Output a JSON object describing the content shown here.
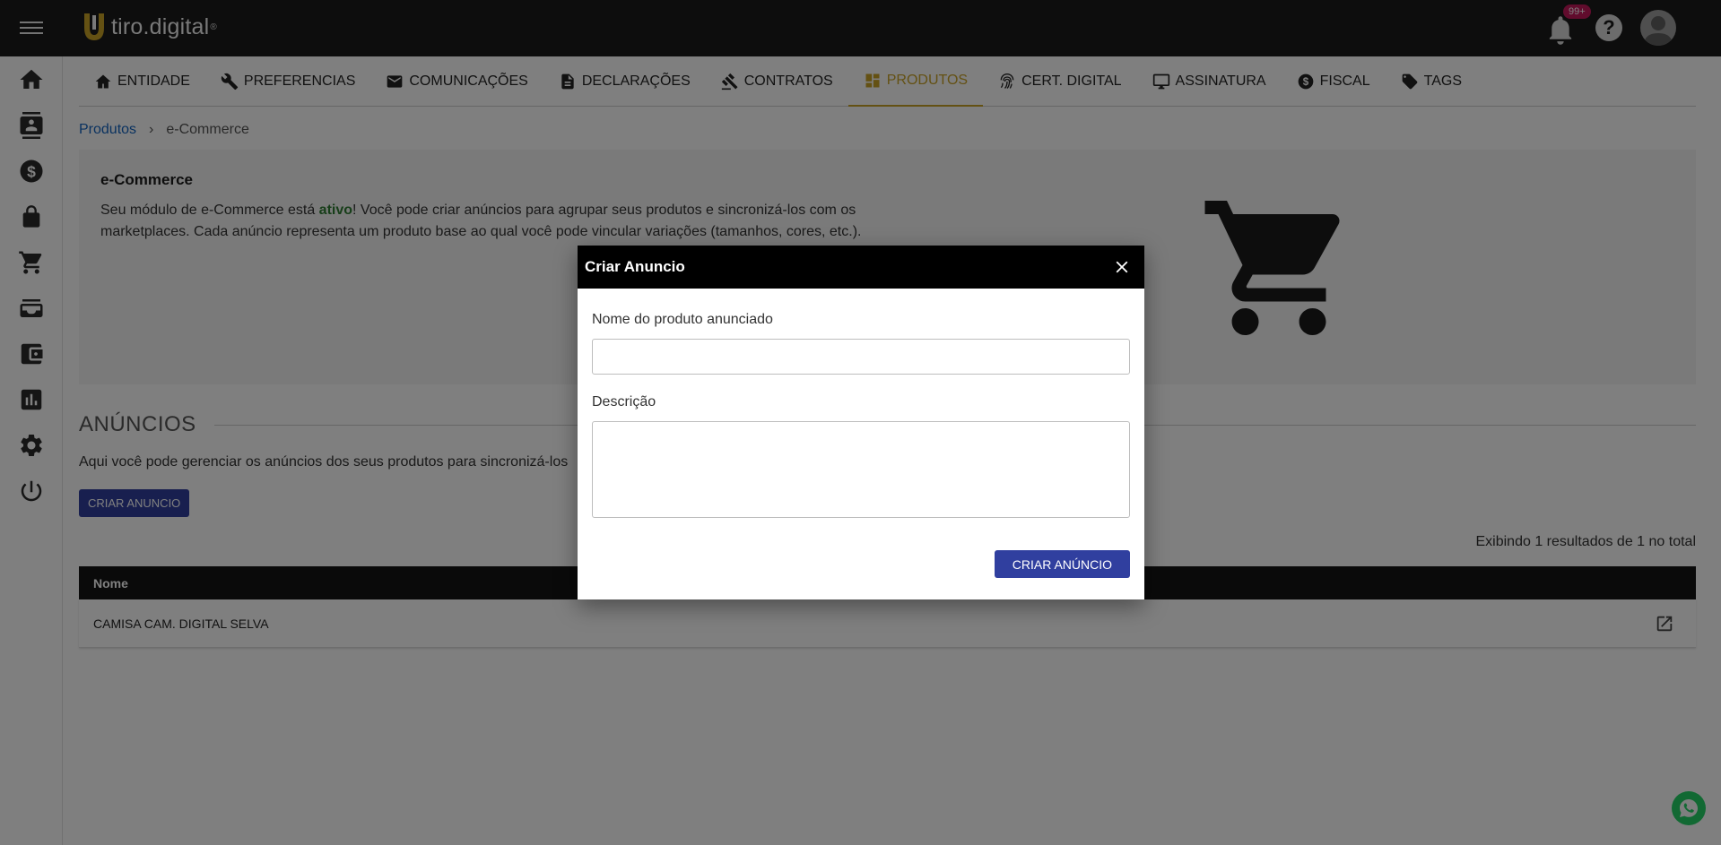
{
  "topbar": {
    "logo_text": "tiro.digital",
    "logo_reg": "®",
    "notification_badge": "99+",
    "help_label": "?"
  },
  "tabs": [
    {
      "label": "ENTIDADE",
      "icon": "house-icon"
    },
    {
      "label": "PREFERENCIAS",
      "icon": "wrench-icon"
    },
    {
      "label": "COMUNICAÇÕES",
      "icon": "mail-icon"
    },
    {
      "label": "DECLARAÇÕES",
      "icon": "document-icon"
    },
    {
      "label": "CONTRATOS",
      "icon": "gavel-icon"
    },
    {
      "label": "PRODUTOS",
      "icon": "dashboard-icon",
      "active": true
    },
    {
      "label": "CERT. DIGITAL",
      "icon": "fingerprint-icon"
    },
    {
      "label": "ASSINATURA",
      "icon": "monitor-icon"
    },
    {
      "label": "FISCAL",
      "icon": "dollar-circle-icon"
    },
    {
      "label": "TAGS",
      "icon": "tag-icon"
    }
  ],
  "breadcrumb": {
    "root": "Produtos",
    "separator": "›",
    "current": "e-Commerce"
  },
  "card": {
    "title": "e-Commerce",
    "text_before": "Seu módulo de e-Commerce está ",
    "status_word": "ativo",
    "text_after": "! Você pode criar anúncios para agrupar seus produtos e sincronizá-los com os marketplaces. Cada anúncio representa um produto base ao qual você pode vincular variações (tamanhos, cores, etc.)."
  },
  "section": {
    "title": "ANÚNCIOS",
    "description": "Aqui você pode gerenciar os anúncios dos seus produtos para sincronizá-los",
    "create_button": "CRIAR ANUNCIO",
    "results": "Exibindo 1 resultados de 1 no total"
  },
  "table": {
    "header": "Nome",
    "rows": [
      {
        "name": "CAMISA CAM. DIGITAL SELVA"
      }
    ]
  },
  "modal": {
    "title": "Criar Anuncio",
    "field_name_label": "Nome do produto anunciado",
    "field_name_value": "",
    "field_desc_label": "Descrição",
    "field_desc_value": "",
    "submit_button": "CRIAR ANÚNCIO"
  },
  "colors": {
    "topbar": "#1b1b1b",
    "accent_gold": "#c9a227",
    "primary_button": "#303f9f",
    "active_status": "#2e7d32",
    "link": "#1565c0",
    "badge": "#c2185b"
  }
}
